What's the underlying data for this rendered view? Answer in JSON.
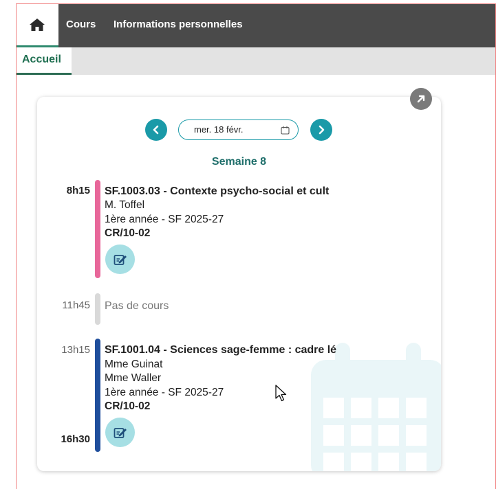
{
  "nav": {
    "home_icon": "home-icon",
    "links": [
      "Cours",
      "Informations personnelles"
    ]
  },
  "subnav": {
    "active_tab": "Accueil"
  },
  "schedule": {
    "date": "mer. 18 févr.",
    "week_label": "Semaine 8",
    "accent_color": "#1a9aa8",
    "courses": [
      {
        "start": "8h15",
        "title": "SF.1003.03 - Contexte psycho-social et cult",
        "teacher": "M. Toffel",
        "group": "1ère année - SF 2025-27",
        "room": "CR/10-02",
        "color": "#e8679a"
      },
      {
        "start": "11h45",
        "gap_label": "Pas de cours",
        "color": "#d9d9d9"
      },
      {
        "start": "13h15",
        "end": "16h30",
        "title": "SF.1001.04 - Sciences sage-femme : cadre lé",
        "teacher_1": "Mme Guinat",
        "teacher_2": "Mme Waller",
        "group": "1ère année - SF 2025-27",
        "room": "CR/10-02",
        "color": "#1f4e9c"
      }
    ]
  }
}
